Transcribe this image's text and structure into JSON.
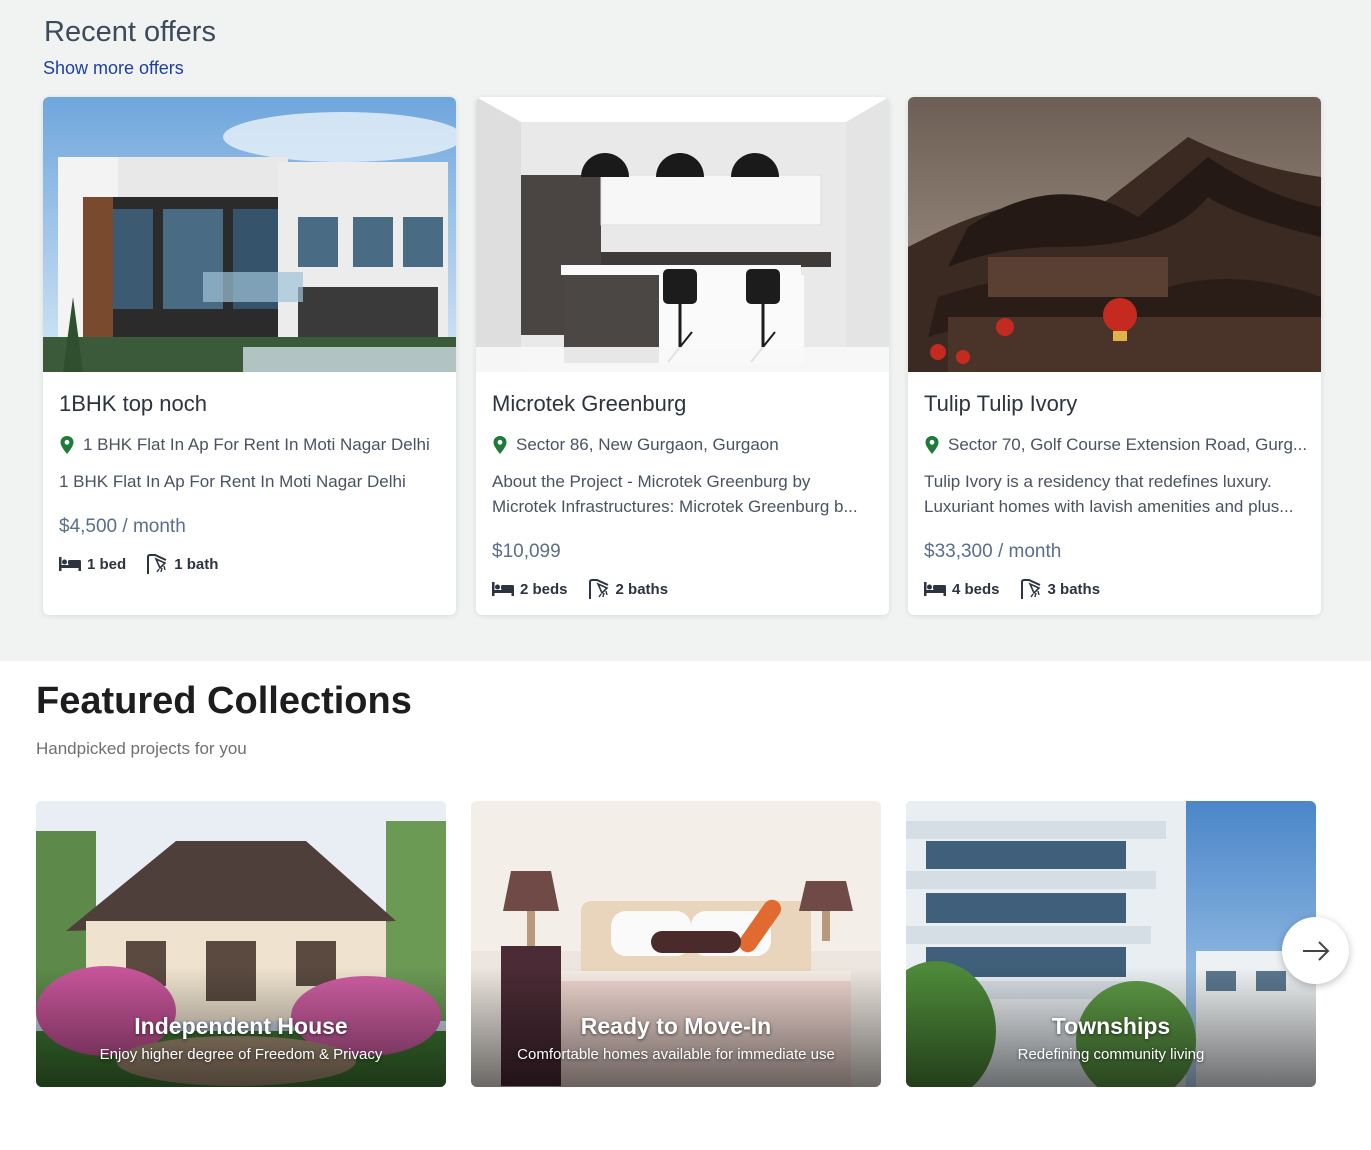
{
  "recent": {
    "title": "Recent offers",
    "show_more": "Show more offers",
    "offers": [
      {
        "title": "1BHK top noch",
        "location": "1 BHK Flat In Ap For Rent In Moti Nagar Delhi",
        "desc_lines": [
          "1 BHK Flat In Ap For Rent In Moti Nagar Delhi"
        ],
        "price": "$4,500 / month",
        "beds": "1 bed",
        "baths": "1 bath",
        "image": "modern-villa-photo"
      },
      {
        "title": "Microtek Greenburg",
        "location": "Sector 86, New Gurgaon, Gurgaon",
        "desc_lines": [
          "About the Project - Microtek Greenburg by",
          "Microtek Infrastructures: Microtek Greenburg b..."
        ],
        "price": "$10,099",
        "beds": "2 beds",
        "baths": "2 baths",
        "image": "modern-kitchen-photo"
      },
      {
        "title": "Tulip Tulip Ivory",
        "location": "Sector 70, Golf Course Extension Road, Gurg...",
        "desc_lines": [
          "Tulip Ivory is a residency that redefines luxury.",
          "Luxuriant homes with lavish amenities and plus..."
        ],
        "price": "$33,300 / month",
        "beds": "4 beds",
        "baths": "3 baths",
        "image": "chinese-temple-photo"
      }
    ]
  },
  "featured": {
    "title_plain": "Featured ",
    "title_bold": "Collections",
    "subtitle": "Handpicked projects for you",
    "collections": [
      {
        "name": "Independent House",
        "desc": "Enjoy higher degree of Freedom & Privacy",
        "image": "house-with-garden-photo"
      },
      {
        "name": "Ready to Move-In",
        "desc": "Comfortable homes available for immediate use",
        "image": "bedroom-photo"
      },
      {
        "name": "Townships",
        "desc": "Redefining community living",
        "image": "apartment-building-photo"
      }
    ]
  },
  "icons": {
    "pin": "location-pin-icon",
    "bed": "bed-icon",
    "bath": "shower-icon",
    "next": "arrow-right-icon"
  },
  "colors": {
    "section_bg": "#f0f3f1",
    "link": "#1f3fa0",
    "pin": "#1e7b3a",
    "price": "#5b6e8a"
  }
}
